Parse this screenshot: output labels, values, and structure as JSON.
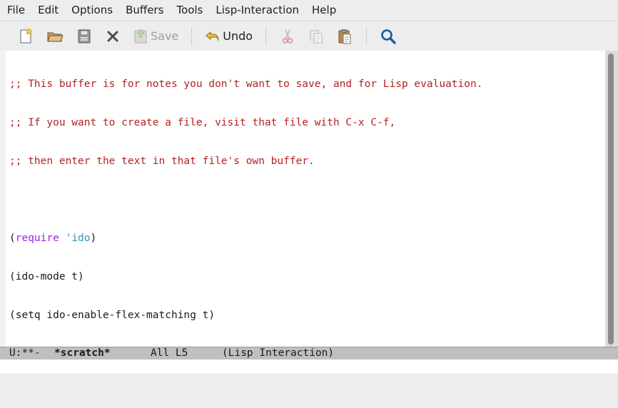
{
  "menubar": {
    "items": [
      "File",
      "Edit",
      "Options",
      "Buffers",
      "Tools",
      "Lisp-Interaction",
      "Help"
    ]
  },
  "toolbar": {
    "new_file": "new-file-icon",
    "open": "open-folder-icon",
    "save_icon": "save-disk-icon",
    "close": "close-icon",
    "save_label": "Save",
    "undo_label": "Undo",
    "cut": "cut-icon",
    "copy": "copy-icon",
    "paste": "paste-icon",
    "search": "search-icon"
  },
  "buffer": {
    "lines": [
      ";; This buffer is for notes you don't want to save, and for Lisp evaluation.",
      ";; If you want to create a file, visit that file with C-x C-f,",
      ";; then enter the text in that file's own buffer.",
      "",
      "(require 'ido)",
      "(ido-mode t)",
      "(setq ido-enable-flex-matching t)"
    ],
    "require_open": "(",
    "require_kw": "require",
    "require_quote": " '",
    "require_sym": "ido",
    "require_close": ")"
  },
  "modeline": {
    "status": "U:**-",
    "buffer_name": "*scratch*",
    "position": "All L5",
    "mode": "(Lisp Interaction)"
  },
  "colors": {
    "comment": "#b22222",
    "keyword": "#a020f0",
    "constant": "#3a8fb7",
    "modeline_bg": "#bfbfbf"
  }
}
